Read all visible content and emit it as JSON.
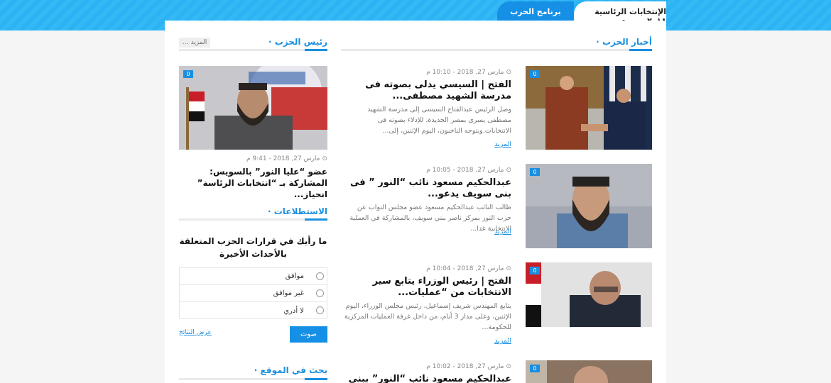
{
  "header": {
    "tabs": [
      {
        "label": "الإنتخابات الرئاسية ٢٠١٨",
        "active": true
      },
      {
        "label": "برنامج الحزب",
        "active": false
      }
    ]
  },
  "news": {
    "section_title": "أخبار الحزب",
    "articles": [
      {
        "badge": "0",
        "date": "مارس 27, 2018 - 10:10 م",
        "title": "الفتح | السيسي يدلى بصوته فى مدرسة الشهيد مصطفى...",
        "excerpt": "وصل الرئيس عبدالفتاح السيسى إلى مدرسة الشهيد مصطفى يسرى بمصر الجديدة، للإدلاء بصوته فى الانتخابات.وبتوجه الناخبون، اليوم الإثنين، إلى...",
        "more": "المزيد"
      },
      {
        "badge": "0",
        "date": "مارس 27, 2018 - 10:05 م",
        "title": "عبدالحكيم مسعود نائب “النور ” فى بنى سويف يدعو...",
        "excerpt": "طالب النائب عبدالحكيم مسعود عضو مجلس النواب عن حزب النور بمركز ناصر ببني سويف، بالمشاركة في العملية الانتخابية غدا...",
        "more": "المزيد"
      },
      {
        "badge": "0",
        "date": "مارس 27, 2018 - 10:04 م",
        "title": "الفتح | رئيس الوزراء يتابع سير الانتخابات من “عمليات...",
        "excerpt": "يتابع المهندس شريف إسماعيل، رئيس مجلس الوزراء، اليوم الإثنين، وعلى مدار 3 أيام، من داخل غرفة العمليات المركزية للحكومة...",
        "more": "المزيد"
      },
      {
        "badge": "0",
        "date": "مارس 27, 2018 - 10:02 م",
        "title": "عبدالحكيم مسعود نائب “النور” ببني سويف"
      }
    ]
  },
  "sidebar": {
    "president": {
      "section_title": "رئيس الحزب",
      "more_label": "المزيد",
      "badge": "0",
      "date": "مارس 27, 2018 - 9:41 م",
      "title": "عضو “عليا النور” بالسويس: المشاركة بـ “انتخابات الرئاسة” انحياز..."
    },
    "polls": {
      "section_title": "الاستطلاعات",
      "question": "ما رأيك في قرارات الحزب المتعلقة بالأحداث الأخيرة",
      "options": [
        "موافق",
        "غير موافق",
        "لا أدري"
      ],
      "vote_label": "صوت",
      "results_label": "عرض النتائج"
    },
    "search": {
      "section_title": "بحث في الموقع"
    }
  }
}
